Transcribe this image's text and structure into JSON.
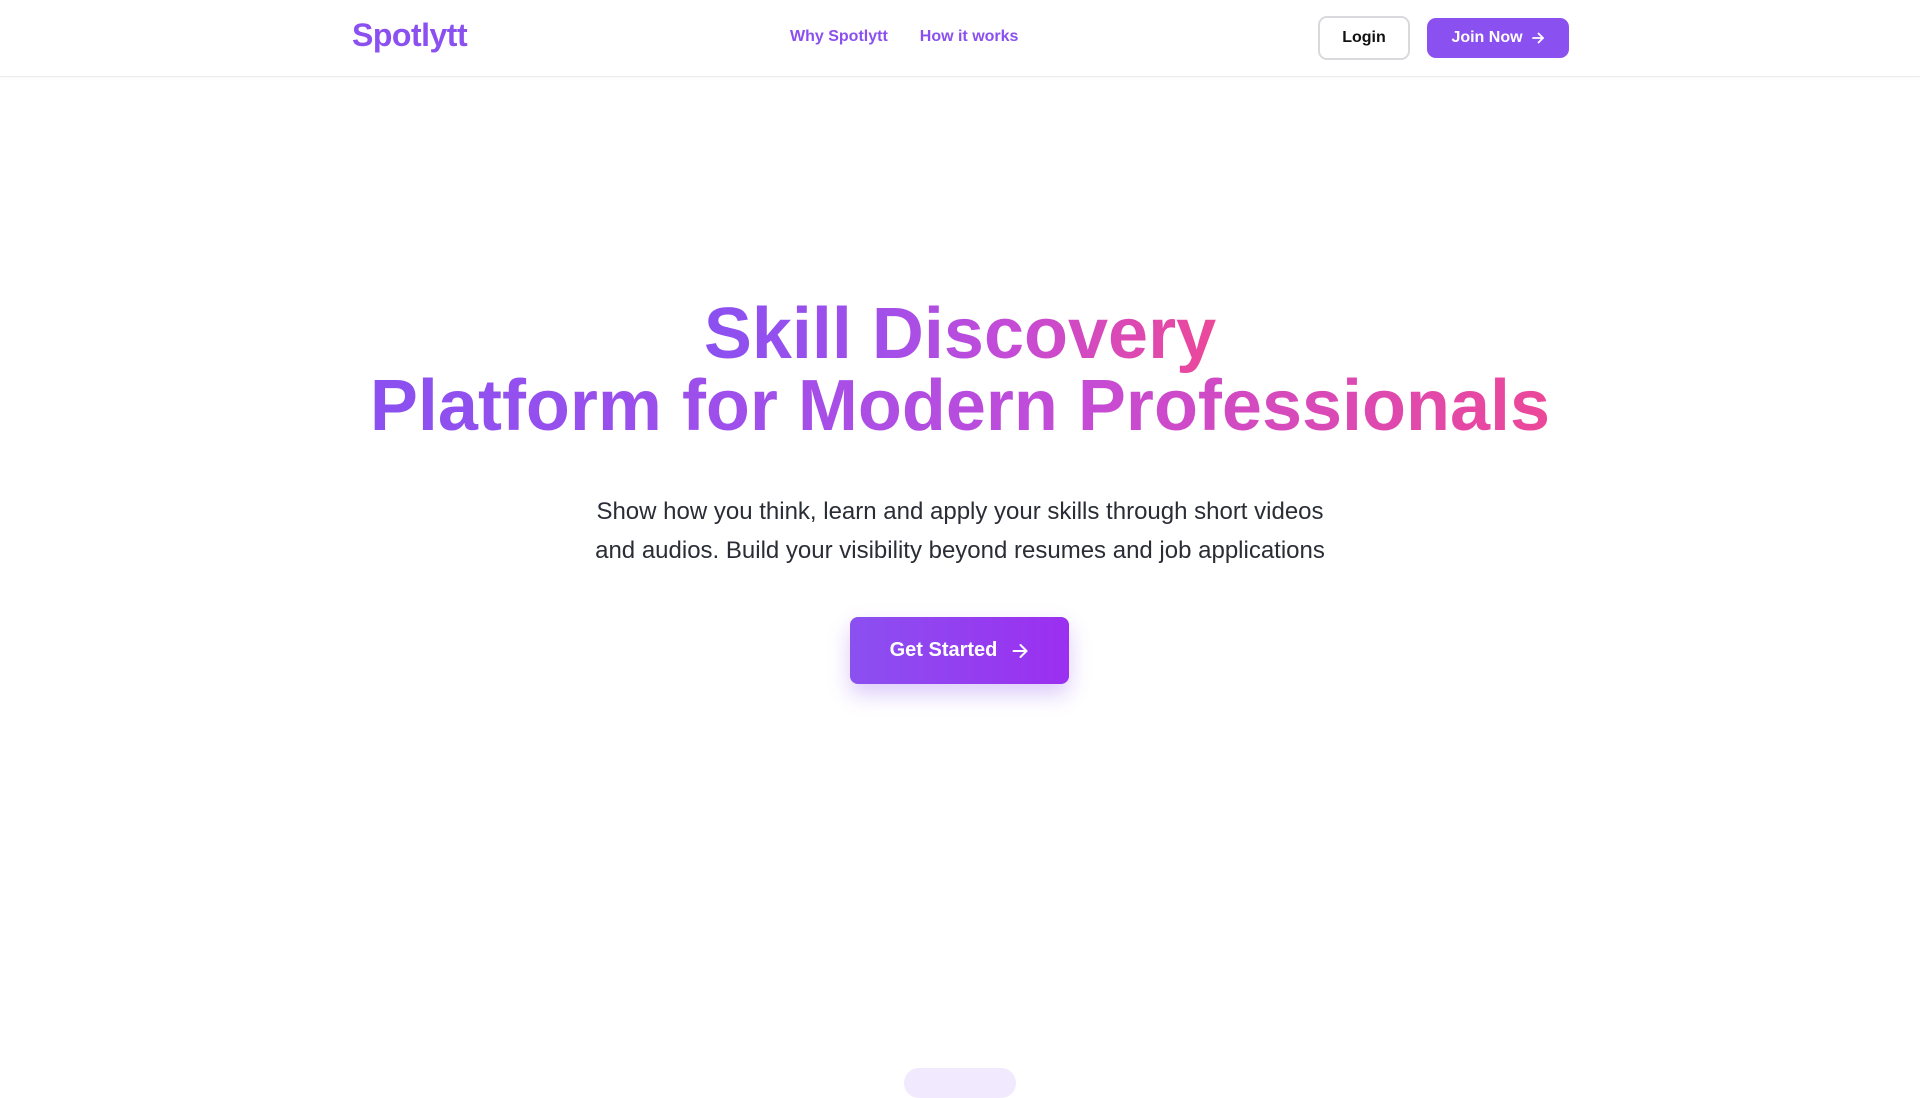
{
  "header": {
    "logo": "Spotlytt",
    "nav": [
      {
        "label": "Why Spotlytt"
      },
      {
        "label": "How it works"
      }
    ],
    "login_label": "Login",
    "join_label": "Join Now"
  },
  "hero": {
    "title_line1": "Skill Discovery",
    "title_line2": "Platform for Modern Professionals",
    "subtitle_line1": "Show how you think, learn and apply your skills through short videos",
    "subtitle_line2": "and audios. Build your visibility beyond resumes and job applications",
    "cta_label": "Get Started"
  },
  "icons": {
    "join_arrow": "arrow-right-icon",
    "cta_arrow": "arrow-right-icon"
  },
  "colors": {
    "brand": "#8b50f0",
    "gradient_end": "#ec4899",
    "text": "#2a2d36"
  }
}
